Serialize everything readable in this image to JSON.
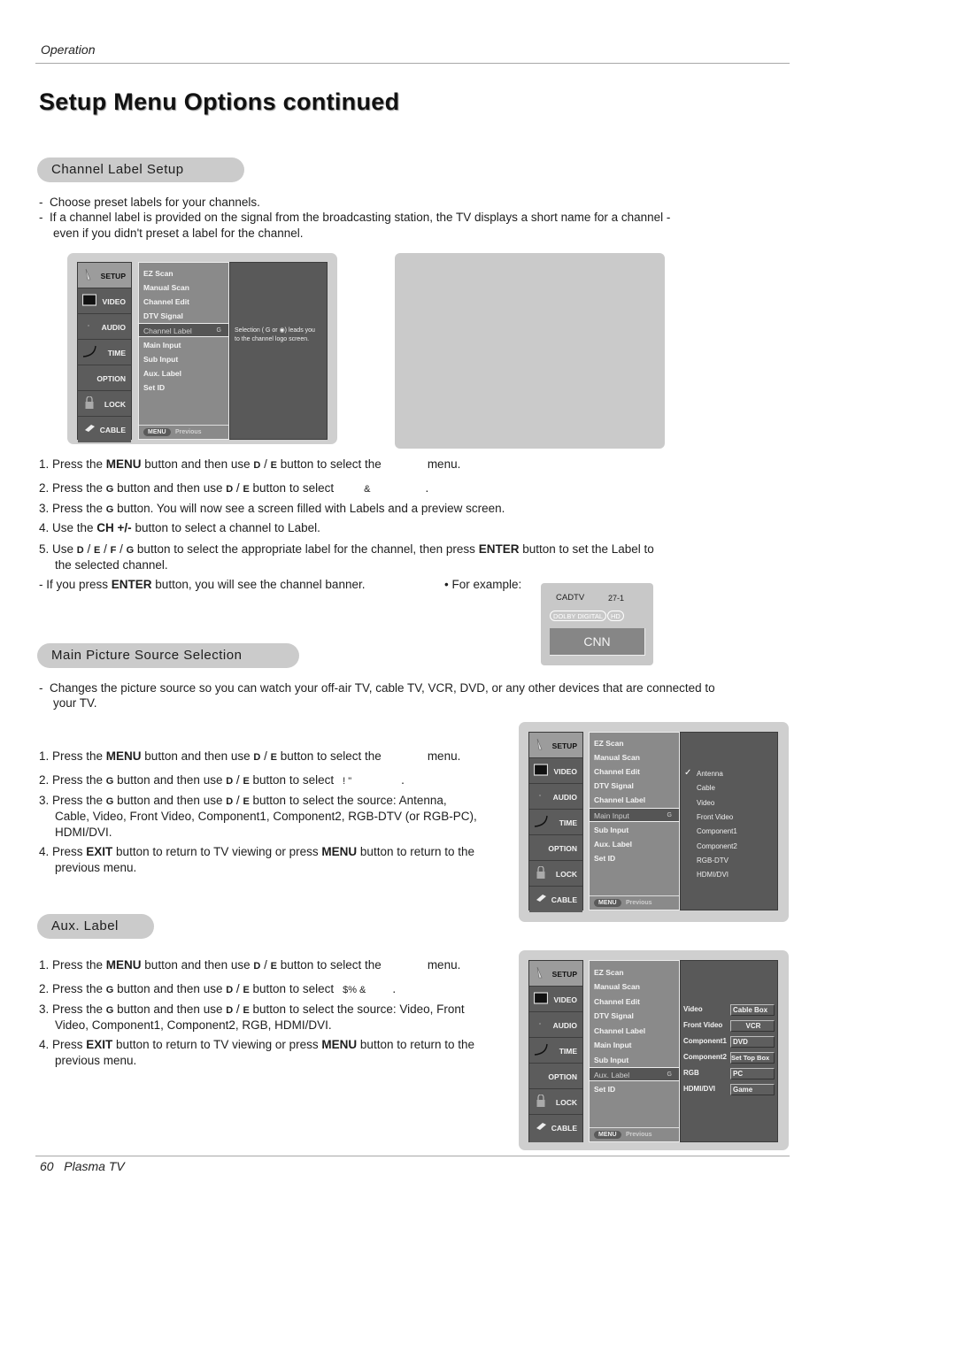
{
  "header": {
    "section": "Operation",
    "title": "Setup Menu Options continued"
  },
  "footer": {
    "page_number": "60",
    "product": "Plasma TV"
  },
  "sections": {
    "channel_label": {
      "heading": "Channel Label Setup",
      "intro": [
        "Choose preset labels for your channels.",
        "If a channel label is provided on the signal from the broadcasting station, the TV displays a short name for a channel -",
        "even if you didn't preset a label for the channel."
      ],
      "steps": {
        "s1a": "1. Press the ",
        "s1b": "MENU",
        "s1c": " button and then use ",
        "s1d": "D",
        "s1e": " / ",
        "s1f": "E",
        "s1g": "  button to select the",
        "s1h": "menu.",
        "s2a": "2. Press the ",
        "s2b": "G",
        "s2c": "  button and then use ",
        "s2d": "D",
        "s2e": " / ",
        "s2f": "E",
        "s2g": " button to select",
        "s2h": "&",
        "s2i": ".",
        "s3a": "3. Press the ",
        "s3b": "G",
        "s3c": "  button. You will now see a screen filled with Labels and a preview screen.",
        "s4a": "4. Use the ",
        "s4b": "CH +/-",
        "s4c": " button to select a channel to Label.",
        "s5a": "5. Use ",
        "s5b": "D",
        "s5c": " / ",
        "s5d": "E",
        "s5e": " / ",
        "s5f": "F",
        "s5g": " / ",
        "s5h": "G",
        "s5i": "  button to select the appropriate label for the channel, then press ",
        "s5j": "ENTER",
        "s5k": " button to set the Label to",
        "s5l": "the selected channel.",
        "note_a": "-  If you press  ",
        "note_b": "ENTER",
        "note_c": "  button, you will see the channel banner.",
        "example": "• For example:"
      },
      "banner": {
        "source": "CADTV",
        "channel": "27-1",
        "chip_audio": "DOLBY DIGITAL",
        "chip_hd": "HD",
        "label": "CNN"
      },
      "menu_hint": [
        "Selection ( G or ◉) leads you",
        "to the channel logo screen."
      ]
    },
    "main_picture": {
      "heading": "Main Picture Source Selection",
      "intro": [
        "Changes the picture source so you can watch your off-air TV, cable TV, VCR, DVD, or any other devices that are connected to",
        "your TV."
      ],
      "steps": {
        "s1a": "1. Press the ",
        "s1b": "MENU",
        "s1c": " button and then use ",
        "s1d": "D",
        "s1e": " / ",
        "s1f": "E",
        "s1g": "  button to select the",
        "s1h": "menu.",
        "s2a": "2. Press the ",
        "s2b": "G",
        "s2c": "  button and then use ",
        "s2d": "D",
        "s2e": " / ",
        "s2f": "E",
        "s2g": " button to select",
        "s2h": "!    \"",
        "s2i": ".",
        "s3a": "3. Press the ",
        "s3b": "G",
        "s3c": "  button and then use ",
        "s3d": "D",
        "s3e": " / ",
        "s3f": "E",
        "s3g": "  button to select the source: Antenna,",
        "s3h": "Cable, Video, Front Video, Component1, Component2, RGB-DTV (or RGB-PC),",
        "s3i": "HDMI/DVI.",
        "s4a": "4. Press ",
        "s4b": "EXIT",
        "s4c": " button to return to TV viewing or press ",
        "s4d": "MENU",
        "s4e": " button to return to the",
        "s4f": "previous menu."
      },
      "sources": [
        "Antenna",
        "Cable",
        "Video",
        "Front Video",
        "Component1",
        "Component2",
        "RGB-DTV",
        "HDMI/DVI"
      ],
      "checked_source": "Antenna"
    },
    "aux_label": {
      "heading": "Aux. Label",
      "steps": {
        "s1a": "1. Press the ",
        "s1b": "MENU",
        "s1c": " button and then use ",
        "s1d": "D",
        "s1e": " / ",
        "s1f": "E",
        "s1g": "  button to select the",
        "s1h": "menu.",
        "s2a": "2. Press the ",
        "s2b": "G",
        "s2c": "  button and then use ",
        "s2d": "D",
        "s2e": " / ",
        "s2f": "E",
        "s2g": " button to select",
        "s2h": "$%  &",
        "s2i": ".",
        "s3a": "3. Press the ",
        "s3b": "G",
        "s3c": "  button and then use ",
        "s3d": "D",
        "s3e": " / ",
        "s3f": "E",
        "s3g": " button to select the source: Video, Front",
        "s3h": "Video, Component1, Component2, RGB, HDMI/DVI.",
        "s4a": "4. Press ",
        "s4b": "EXIT",
        "s4c": " button to return to TV viewing or press ",
        "s4d": "MENU",
        "s4e": " button to return to the",
        "s4f": "previous menu."
      },
      "labels": [
        {
          "input": "Video",
          "label": "Cable Box"
        },
        {
          "input": "Front Video",
          "label": "VCR"
        },
        {
          "input": "Component1",
          "label": "DVD"
        },
        {
          "input": "Component2",
          "label": "Set Top Box"
        },
        {
          "input": "RGB",
          "label": "PC"
        },
        {
          "input": "HDMI/DVI",
          "label": "Game"
        }
      ]
    }
  },
  "tv_menu": {
    "categories": [
      "SETUP",
      "VIDEO",
      "AUDIO",
      "TIME",
      "OPTION",
      "LOCK",
      "CABLE"
    ],
    "items": [
      "EZ Scan",
      "Manual  Scan",
      "Channel Edit",
      "DTV Signal",
      "Channel Label",
      "Main Input",
      "Sub Input",
      "Aux. Label",
      "Set ID"
    ],
    "items_alt": [
      "EZ Scan",
      "Manual  Scan",
      "Channel Edit",
      "DTV Signal",
      "Channel  Label",
      "Main Input",
      "Sub Input",
      "Aux. Label",
      "Set ID"
    ],
    "arrow": "G",
    "footer_button": "MENU",
    "footer_text": "Previous"
  }
}
